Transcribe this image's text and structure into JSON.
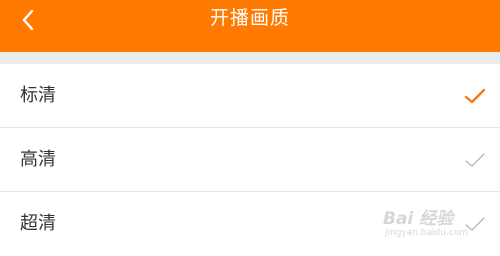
{
  "header": {
    "title": "开播画质",
    "back_icon": "chevron-left-icon",
    "background_color": "#ff7a00"
  },
  "options": [
    {
      "label": "标清",
      "selected": true
    },
    {
      "label": "高清",
      "selected": false
    },
    {
      "label": "超清",
      "selected": false
    }
  ],
  "colors": {
    "check_selected": "#f07a1e",
    "check_unselected": "#b8b8b8"
  },
  "watermark": {
    "main": "Bai 经验",
    "sub": "jingyan.baidu.com"
  }
}
